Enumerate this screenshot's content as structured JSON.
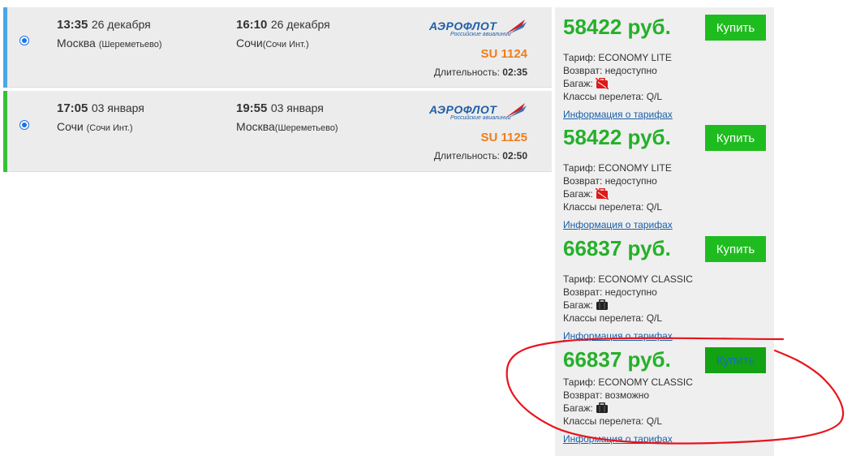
{
  "flights": [
    {
      "depart": {
        "time": "13:35",
        "date": "26 декабря",
        "city": "Москва",
        "airport": "(Шереметьево)"
      },
      "arrive": {
        "time": "16:10",
        "date": "26 декабря",
        "city": "Сочи",
        "airport": "(Сочи Инт.)"
      },
      "airline": {
        "name": "АЭРОФЛОТ",
        "tagline": "Российские авиалинии"
      },
      "flight_number": "SU 1124",
      "duration_label": "Длительность:",
      "duration": "02:35",
      "accent": "#4aa7ea"
    },
    {
      "depart": {
        "time": "17:05",
        "date": "03 января",
        "city": "Сочи",
        "airport": "(Сочи Инт.)"
      },
      "arrive": {
        "time": "19:55",
        "date": "03 января",
        "city": "Москва",
        "airport": "(Шереметьево)"
      },
      "airline": {
        "name": "АЭРОФЛОТ",
        "tagline": "Российские авиалинии"
      },
      "flight_number": "SU 1125",
      "duration_label": "Длительность:",
      "duration": "02:50",
      "accent": "#35c23a"
    }
  ],
  "offers": [
    {
      "price": "58422 руб.",
      "buy_label": "Купить",
      "tariff": "Тариф: ECONOMY LITE",
      "refund": "Возврат: недоступно",
      "baggage_label": "Багаж:",
      "baggage_icon": "no-baggage-icon",
      "classes": "Классы перелета: Q/L",
      "info_link": "Информация о тарифах"
    },
    {
      "price": "58422 руб.",
      "buy_label": "Купить",
      "tariff": "Тариф: ECONOMY LITE",
      "refund": "Возврат: недоступно",
      "baggage_label": "Багаж:",
      "baggage_icon": "no-baggage-icon",
      "classes": "Классы перелета: Q/L",
      "info_link": "Информация о тарифах"
    },
    {
      "price": "66837 руб.",
      "buy_label": "Купить",
      "tariff": "Тариф: ECONOMY CLASSIC",
      "refund": "Возврат: недоступно",
      "baggage_label": "Багаж:",
      "baggage_icon": "baggage-icon",
      "classes": "Классы перелета: Q/L",
      "info_link": "Информация о тарифах"
    },
    {
      "price": "66837 руб.",
      "buy_label": "Купить",
      "tariff": "Тариф: ECONOMY CLASSIC",
      "refund": "Возврат: возможно",
      "baggage_label": "Багаж:",
      "baggage_icon": "baggage-icon",
      "classes": "Классы перелета: Q/L",
      "info_link": "Информация о тарифах",
      "highlighted": true
    }
  ],
  "colors": {
    "price": "#25b02a",
    "buy": "#1fbc1f",
    "flight_number": "#ef7d1a",
    "link": "#1a5fa8",
    "annotation": "#e8141c"
  }
}
